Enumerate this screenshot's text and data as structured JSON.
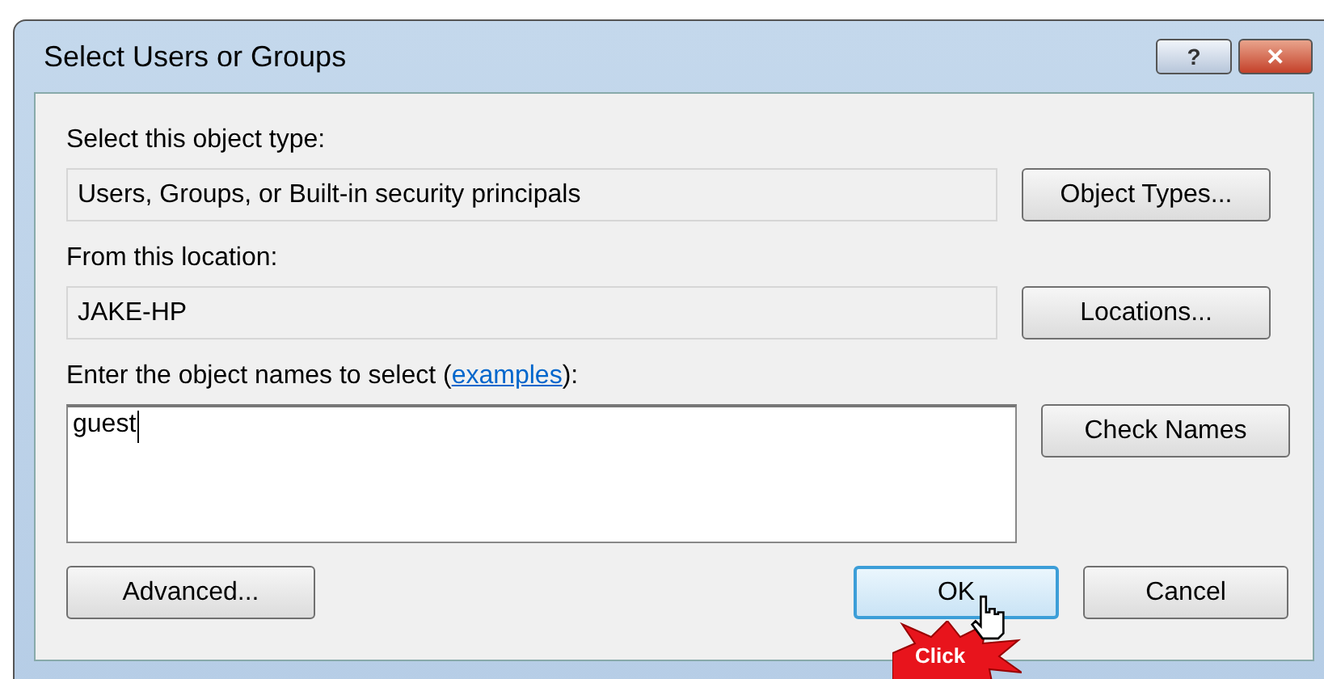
{
  "window": {
    "title": "Select Users or Groups"
  },
  "title_buttons": [
    {
      "kind": "help",
      "label": "?"
    },
    {
      "kind": "close",
      "label": "✕"
    }
  ],
  "rows": [
    {
      "label": "Select this object type:",
      "value": "Users, Groups, or Built-in security principals",
      "button": "Object Types..."
    },
    {
      "label": "From this location:",
      "value": "JAKE-HP",
      "button": "Locations..."
    }
  ],
  "names": {
    "label": "Enter the object names to select (",
    "link": "examples",
    "label_end": "):",
    "value": "guest",
    "button": "Check Names"
  },
  "buttons": [
    {
      "label": "Advanced...",
      "default": false
    },
    {
      "label": "OK",
      "default": true
    },
    {
      "label": "Cancel",
      "default": false
    }
  ],
  "annotation": {
    "label": "Click"
  }
}
